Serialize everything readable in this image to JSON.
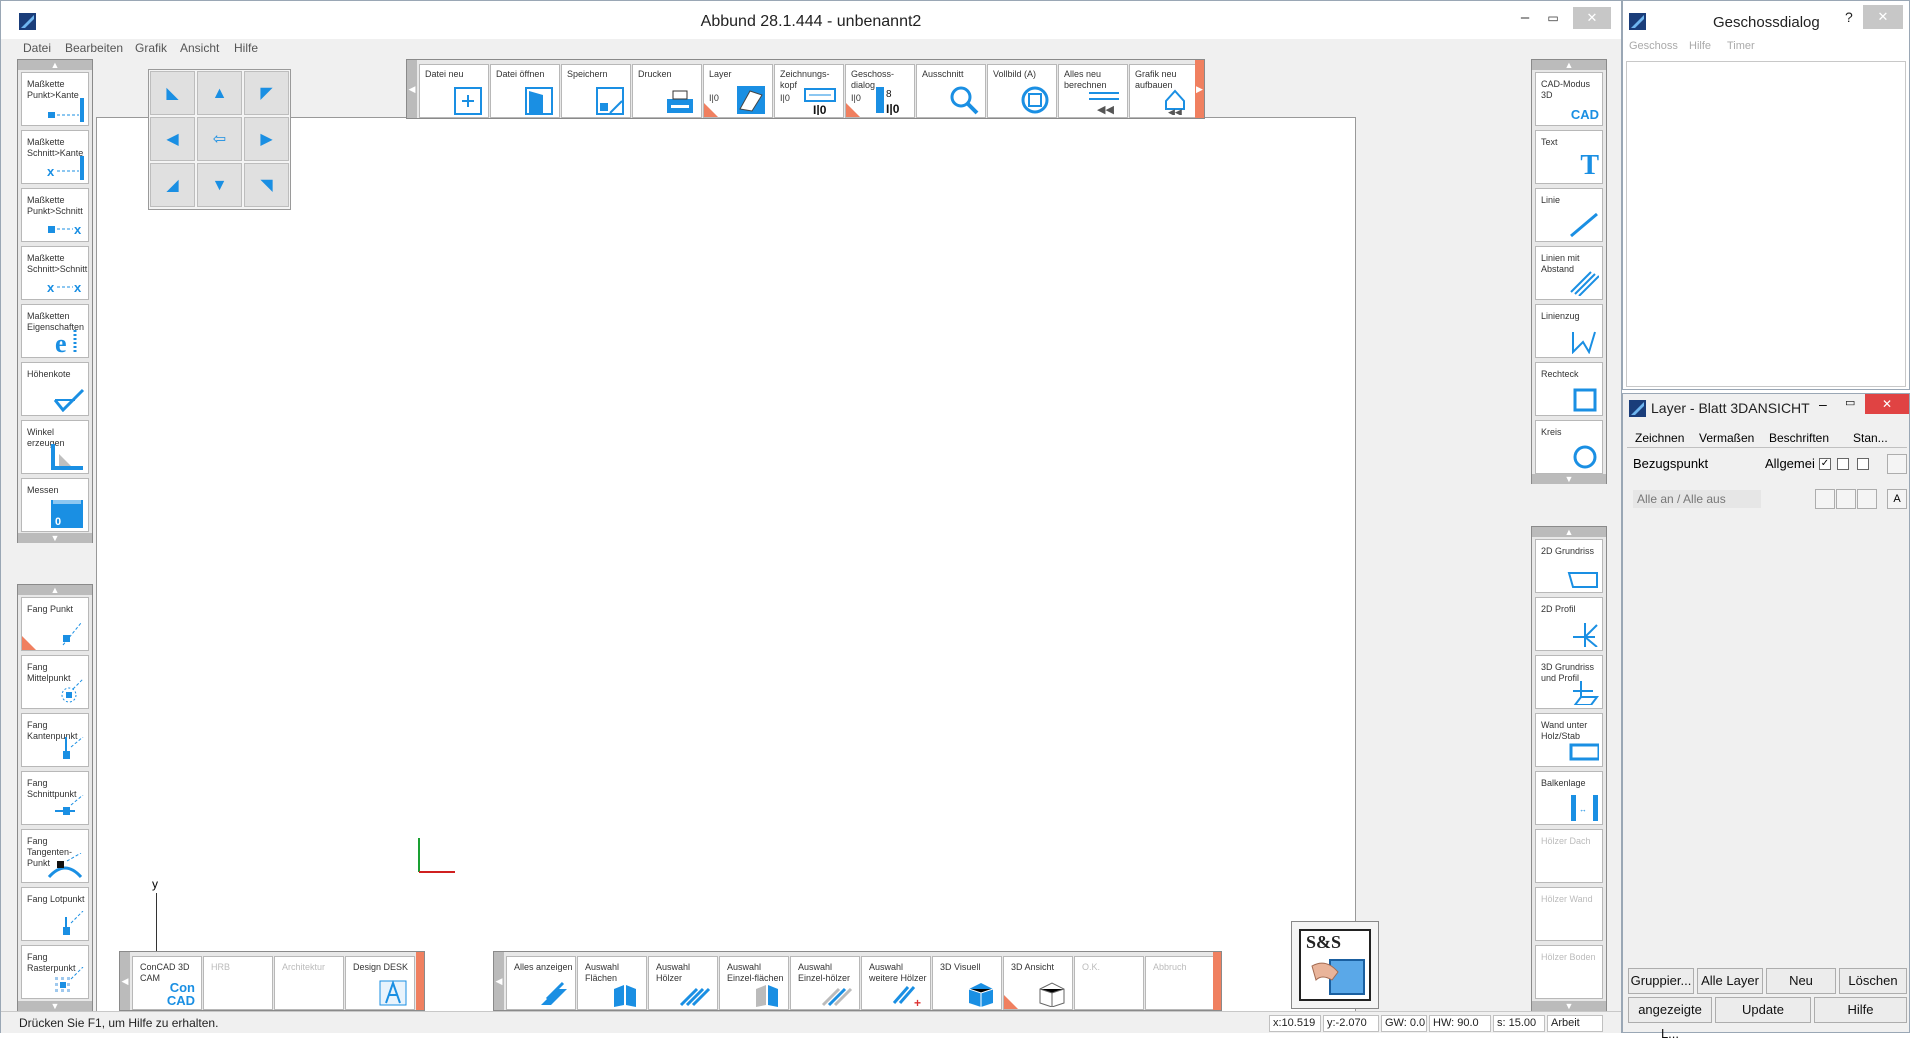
{
  "window": {
    "title": "Abbund 28.1.444 - unbenannt2",
    "min": "–",
    "max": "▭",
    "close": "✕"
  },
  "menu": [
    "Datei",
    "Bearbeiten",
    "Grafik",
    "Ansicht",
    "Hilfe"
  ],
  "left_toolbar_1": [
    {
      "label": "Maßkette Punkt>Kante",
      "icon": "dim-point-edge-icon"
    },
    {
      "label": "Maßkette Schnitt>Kante",
      "icon": "dim-cut-edge-icon"
    },
    {
      "label": "Maßkette Punkt>Schnitt",
      "icon": "dim-point-cut-icon"
    },
    {
      "label": "Maßkette Schnitt>Schnitt",
      "icon": "dim-cut-cut-icon"
    },
    {
      "label": "Maßketten Eigenschaften",
      "icon": "dim-properties-icon"
    },
    {
      "label": "Höhenkote",
      "icon": "height-mark-icon"
    },
    {
      "label": "Winkel erzeugen",
      "icon": "angle-icon"
    },
    {
      "label": "Messen",
      "icon": "ruler-icon"
    }
  ],
  "left_toolbar_2": [
    {
      "label": "Fang Punkt"
    },
    {
      "label": "Fang Mittelpunkt"
    },
    {
      "label": "Fang Kantenpunkt"
    },
    {
      "label": "Fang Schnittpunkt"
    },
    {
      "label": "Fang Tangenten-Punkt"
    },
    {
      "label": "Fang Lotpunkt"
    },
    {
      "label": "Fang Rasterpunkt"
    }
  ],
  "top_toolbar": [
    {
      "label": "Datei neu"
    },
    {
      "label": "Datei öffnen"
    },
    {
      "label": "Speichern"
    },
    {
      "label": "Drucken"
    },
    {
      "label": "Layer",
      "sub": "I|0"
    },
    {
      "label": "Zeichnungs-kopf",
      "sub": "I|0"
    },
    {
      "label": "Geschoss-dialog",
      "sub": "I|0"
    },
    {
      "label": "Ausschnitt"
    },
    {
      "label": "Vollbild (A)"
    },
    {
      "label": "Alles neu berechnen"
    },
    {
      "label": "Grafik neu aufbauen"
    }
  ],
  "right_toolbar_1": [
    {
      "label": "CAD-Modus 3D",
      "icon_text": "CAD"
    },
    {
      "label": "Text",
      "icon_text": "T"
    },
    {
      "label": "Linie"
    },
    {
      "label": "Linien mit Abstand"
    },
    {
      "label": "Linienzug"
    },
    {
      "label": "Rechteck"
    },
    {
      "label": "Kreis"
    }
  ],
  "right_toolbar_2": [
    {
      "label": "2D Grundriss",
      "enabled": true
    },
    {
      "label": "2D Profil",
      "enabled": true
    },
    {
      "label": "3D Grundriss und Profil",
      "enabled": true
    },
    {
      "label": "Wand unter Holz/Stab",
      "enabled": true
    },
    {
      "label": "Balkenlage",
      "enabled": true
    },
    {
      "label": "Hölzer Dach",
      "enabled": false
    },
    {
      "label": "Hölzer Wand",
      "enabled": false
    },
    {
      "label": "Hölzer Boden",
      "enabled": false
    }
  ],
  "bottom_toolbar_1": [
    {
      "label": "ConCAD 3D CAM",
      "icon_text": "Con CAD",
      "enabled": true
    },
    {
      "label": "HRB",
      "enabled": false
    },
    {
      "label": "Architektur",
      "enabled": false
    },
    {
      "label": "Design DESK",
      "enabled": true
    }
  ],
  "bottom_toolbar_2": [
    {
      "label": "Alles anzeigen",
      "enabled": true
    },
    {
      "label": "Auswahl Flächen",
      "enabled": true
    },
    {
      "label": "Auswahl Hölzer",
      "enabled": true
    },
    {
      "label": "Auswahl Einzel-flächen",
      "enabled": true
    },
    {
      "label": "Auswahl Einzel-hölzer",
      "enabled": true
    },
    {
      "label": "Auswahl weitere Hölzer",
      "enabled": true
    },
    {
      "label": "3D Visuell",
      "enabled": true
    },
    {
      "label": "3D Ansicht",
      "enabled": true
    },
    {
      "label": "O.K.",
      "enabled": false
    },
    {
      "label": "Abbruch",
      "enabled": false
    }
  ],
  "axis_label": "y",
  "logo_text": "S&S",
  "status": {
    "help": "Drücken Sie F1, um Hilfe zu erhalten.",
    "x": "x:10.519",
    "y": "y:-2.070",
    "gw": "GW: 0.0",
    "hw": "HW: 90.0",
    "s": "s: 15.00",
    "mode": "Arbeit"
  },
  "geschoss": {
    "title": "Geschossdialog",
    "help": "?",
    "close": "✕",
    "menu": [
      "Geschoss",
      "Hilfe",
      "Timer"
    ]
  },
  "layer": {
    "title": "Layer - Blatt 3DANSICHT",
    "min": "–",
    "max": "▭",
    "close": "✕",
    "tabs": [
      "Zeichnen",
      "Vermaßen",
      "Beschriften",
      "Stan..."
    ],
    "row_name": "Bezugspunkt",
    "row_group": "Allgemei",
    "all_toggle": "Alle an / Alle aus",
    "a_btn": "A",
    "buttons": [
      "Gruppier...",
      "Alle Layer",
      "Neu",
      "Löschen",
      "angezeigte L...",
      "Update",
      "Hilfe"
    ]
  },
  "colors": {
    "accent": "#1a8fe3",
    "corner": "#f08060",
    "close_red": "#e04343"
  }
}
